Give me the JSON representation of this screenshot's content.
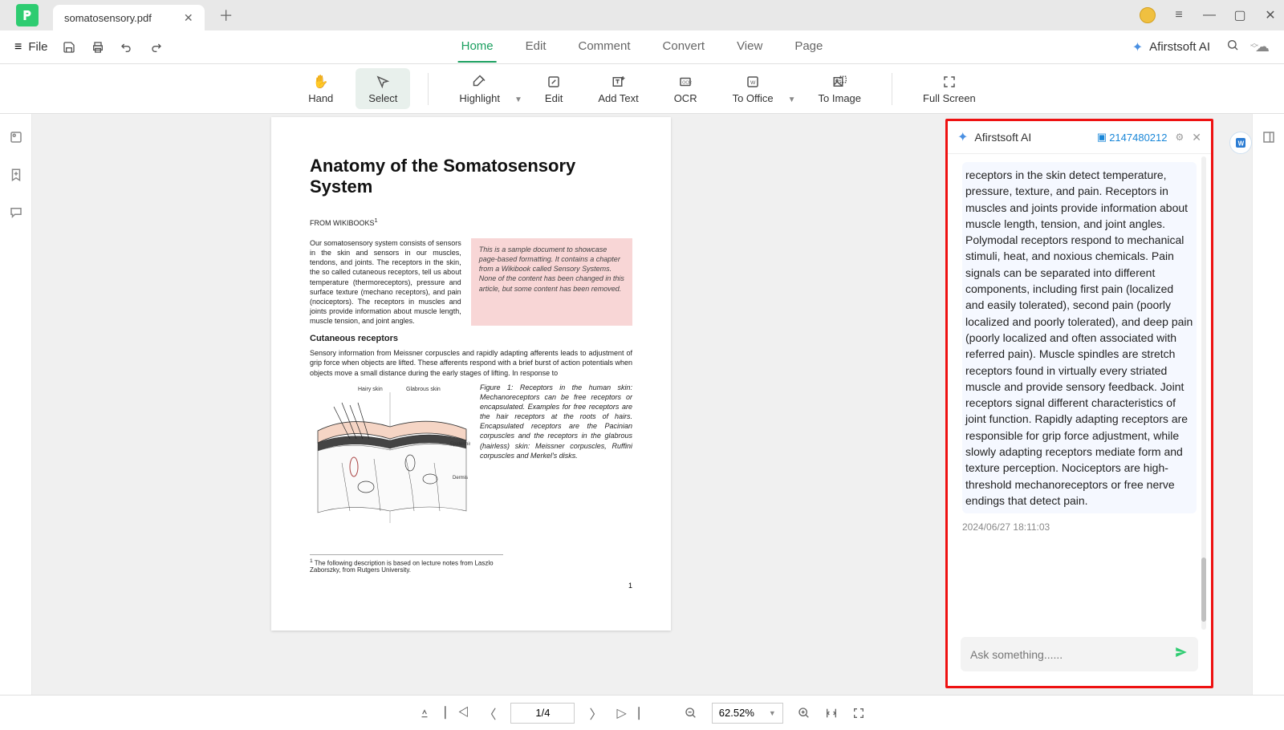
{
  "tab": {
    "title": "somatosensory.pdf"
  },
  "file_menu": {
    "label": "File"
  },
  "main_tabs": [
    "Home",
    "Edit",
    "Comment",
    "Convert",
    "View",
    "Page"
  ],
  "ai_brand": "Afirstsoft AI",
  "toolbar": {
    "hand": "Hand",
    "select": "Select",
    "highlight": "Highlight",
    "edit": "Edit",
    "add_text": "Add Text",
    "ocr": "OCR",
    "to_office": "To Office",
    "to_image": "To Image",
    "full_screen": "Full Screen"
  },
  "doc": {
    "title": "Anatomy of the Somatosensory System",
    "source": "FROM WIKIBOOKS",
    "source_sup": "1",
    "intro": "Our somatosensory system consists of sensors in the skin and sensors in our muscles, tendons, and joints. The receptors in the skin, the so called cutaneous receptors, tell us about temperature (thermoreceptors), pressure and surface texture (mechano receptors), and pain (nociceptors). The receptors in muscles and joints provide information about muscle length, muscle tension, and joint angles.",
    "note": "This is a sample document to showcase page-based formatting. It contains a chapter from a Wikibook called Sensory Systems. None of the content has been changed in this article, but some content has been removed.",
    "section_h": "Cutaneous receptors",
    "section_body": "Sensory information from Meissner corpuscles and rapidly adapting afferents leads to adjustment of grip force when objects are lifted. These afferents respond with a brief burst of action potentials when objects move a small distance during the early stages of lifting. In response to",
    "fig_label_hairy": "Hairy skin",
    "fig_label_glabrous": "Glabrous skin",
    "fig_label_epidermis": "Epidermis",
    "fig_label_dermis": "Dermis",
    "fig_caption": "Figure 1:  Receptors in the human skin: Mechanoreceptors can be free receptors or encapsulated. Examples for free receptors are the hair receptors at the roots of hairs. Encapsulated receptors are the Pacinian corpuscles and the receptors in the glabrous (hairless) skin: Meissner corpuscles, Ruffini corpuscles and Merkel's disks.",
    "footnote": "The following description is based on lecture notes from Laszlo Zaborszky, from Rutgers University.",
    "footnote_num": "1",
    "page_num": "1"
  },
  "ai_panel": {
    "title": "Afirstsoft AI",
    "session_id": "2147480212",
    "message": "receptors in the skin detect temperature, pressure, texture, and pain. Receptors in muscles and joints provide information about muscle length, tension, and joint angles. Polymodal receptors respond to mechanical stimuli, heat, and noxious chemicals. Pain signals can be separated into different components, including first pain (localized and easily tolerated), second pain (poorly localized and poorly tolerated), and deep pain (poorly localized and often associated with referred pain). Muscle spindles are stretch receptors found in virtually every striated muscle and provide sensory feedback. Joint receptors signal different characteristics of joint function. Rapidly adapting receptors are responsible for grip force adjustment, while slowly adapting receptors mediate form and texture perception. Nociceptors are high-threshold mechanoreceptors or free nerve endings that detect pain.",
    "timestamp": "2024/06/27 18:11:03",
    "placeholder": "Ask something......"
  },
  "status": {
    "page": "1/4",
    "zoom": "62.52%"
  }
}
